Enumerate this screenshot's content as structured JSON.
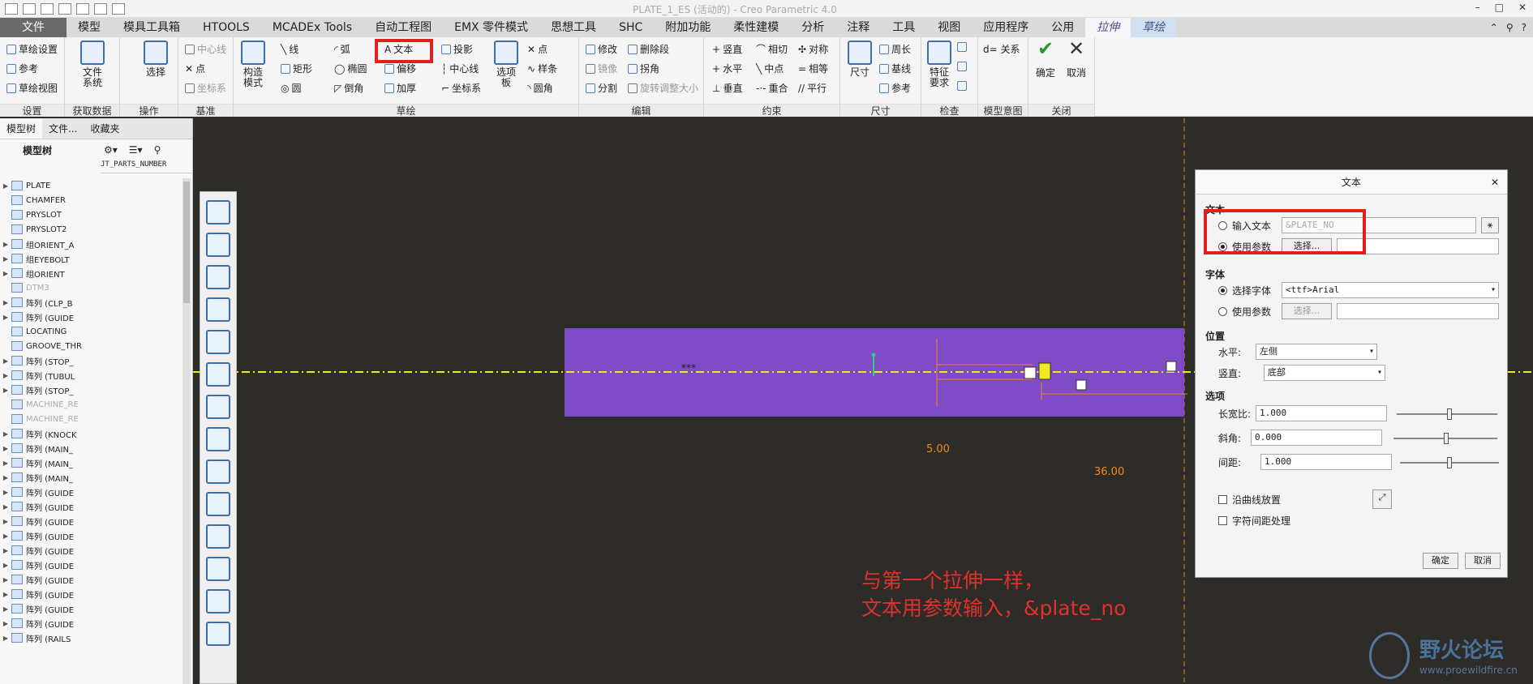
{
  "window": {
    "title": "PLATE_1_ES (活动的) - Creo Parametric 4.0"
  },
  "tabs": [
    "文件",
    "模型",
    "模具工具箱",
    "HTOOLS",
    "MCADEx Tools",
    "自动工程图",
    "EMX 零件模式",
    "思想工具",
    "SHC",
    "附加功能",
    "柔性建模",
    "分析",
    "注释",
    "工具",
    "视图",
    "应用程序",
    "公用",
    "拉伸",
    "草绘"
  ],
  "ribbon": {
    "settings": {
      "label": "设置",
      "items": [
        "草绘设置",
        "参考",
        "草绘视图"
      ]
    },
    "getdata": {
      "label": "获取数据",
      "file_system": "文件\n系统"
    },
    "ops": {
      "label": "操作",
      "select": "选择"
    },
    "datum": {
      "label": "基准",
      "items": [
        "中心线",
        "点",
        "坐标系"
      ]
    },
    "sketch": {
      "label": "草绘",
      "construct": "构造\n模式",
      "items": [
        "线",
        "弧",
        "文本",
        "投影",
        "矩形",
        "椭圆",
        "偏移",
        "中心线",
        "圆",
        "倒角",
        "加厚",
        "坐标系",
        "点",
        "样条",
        "圆角"
      ],
      "palette": "选项\n板"
    },
    "edit": {
      "label": "编辑",
      "items": [
        "修改",
        "删除段",
        "镜像",
        "拐角",
        "分割",
        "旋转调整大小"
      ]
    },
    "constrain": {
      "label": "约束",
      "items": [
        "竖直",
        "相切",
        "对称",
        "水平",
        "中点",
        "相等",
        "垂直",
        "重合",
        "平行"
      ]
    },
    "dimension": {
      "label": "尺寸",
      "dim": "尺寸",
      "items": [
        "周长",
        "基线",
        "参考"
      ]
    },
    "inspect": {
      "label": "检查",
      "feature": "特征\n要求"
    },
    "intent": {
      "label": "模型意图",
      "relations": "d= 关系"
    },
    "close": {
      "label": "关闭",
      "ok": "确定",
      "cancel": "取消"
    }
  },
  "left_panel": {
    "tabs": [
      "模型树",
      "文件...",
      "收藏夹"
    ],
    "header": "模型树",
    "column": "JT_PARTS_NUMBER",
    "items": [
      "PLATE",
      "CHAMFER",
      "PRYSLOT",
      "PRYSLOT2",
      "组ORIENT_A",
      "组EYEBOLT",
      "组ORIENT",
      "DTM3",
      "阵列 (CLP_B",
      "阵列 (GUIDE",
      "LOCATING",
      "GROOVE_THR",
      "阵列 (STOP_",
      "阵列 (TUBUL",
      "阵列 (STOP_",
      "MACHINE_RE",
      "MACHINE_RE",
      "阵列 (KNOCK",
      "阵列 (MAIN_",
      "阵列 (MAIN_",
      "阵列 (MAIN_",
      "阵列 (GUIDE",
      "阵列 (GUIDE",
      "阵列 (GUIDE",
      "阵列 (GUIDE",
      "阵列 (GUIDE",
      "阵列 (GUIDE",
      "阵列 (GUIDE",
      "阵列 (GUIDE",
      "阵列 (GUIDE",
      "阵列 (GUIDE",
      "阵列 (RAILS"
    ]
  },
  "canvas": {
    "dim_vertical": "5.00",
    "dim_horizontal": "36.00",
    "placeholder_text": "***"
  },
  "dialog": {
    "title": "文本",
    "section_text": "文本",
    "input_text_label": "输入文本",
    "input_text_value": "&PLATE_NO",
    "use_param_label": "使用参数",
    "select_btn": "选择...",
    "section_font": "字体",
    "select_font_label": "选择字体",
    "font_value": "<ttf>Arial",
    "font_param_label": "使用参数",
    "font_select_btn": "选择...",
    "section_position": "位置",
    "horizontal_label": "水平:",
    "horizontal_value": "左侧",
    "vertical_label": "竖直:",
    "vertical_value": "底部",
    "section_options": "选项",
    "aspect_label": "长宽比:",
    "aspect_value": "1.000",
    "slant_label": "斜角:",
    "slant_value": "0.000",
    "spacing_label": "间距:",
    "spacing_value": "1.000",
    "along_curve": "沿曲线放置",
    "kerning": "字符间距处理",
    "ok": "确定",
    "cancel": "取消"
  },
  "annotation": {
    "line1": "与第一个拉伸一样，",
    "line2": "文本用参数输入，&plate_no"
  },
  "watermark": {
    "name": "野火论坛",
    "url": "www.proewildfire.cn"
  },
  "colors": {
    "plate": "#7f4bc6",
    "highlight": "#e0201a",
    "annotation": "#e2302a",
    "canvas": "#2e2c29"
  }
}
